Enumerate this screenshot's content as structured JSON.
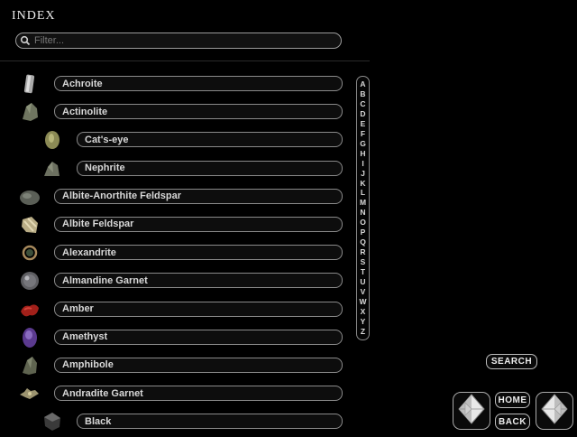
{
  "title": "INDEX",
  "filter": {
    "placeholder": "Filter..."
  },
  "items": [
    {
      "label": "Achroite"
    },
    {
      "label": "Actinolite"
    },
    {
      "label": "Cat's-eye"
    },
    {
      "label": "Nephrite"
    },
    {
      "label": "Albite-Anorthite Feldspar"
    },
    {
      "label": "Albite Feldspar"
    },
    {
      "label": "Alexandrite"
    },
    {
      "label": "Almandine Garnet"
    },
    {
      "label": "Amber"
    },
    {
      "label": "Amethyst"
    },
    {
      "label": "Amphibole"
    },
    {
      "label": "Andradite Garnet"
    },
    {
      "label": "Black"
    }
  ],
  "alphabet": [
    "A",
    "B",
    "C",
    "D",
    "E",
    "F",
    "G",
    "H",
    "I",
    "J",
    "K",
    "L",
    "M",
    "N",
    "O",
    "P",
    "Q",
    "R",
    "S",
    "T",
    "U",
    "V",
    "W",
    "X",
    "Y",
    "Z"
  ],
  "buttons": {
    "search": "SEARCH",
    "home": "HOME",
    "back": "BACK"
  }
}
